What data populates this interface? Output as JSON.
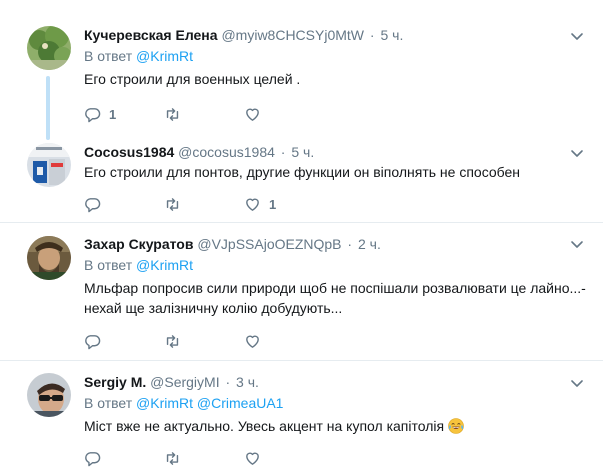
{
  "tweets": [
    {
      "name": "Кучеревская Елена",
      "handle": "@myiw8CHCSYj0MtW",
      "dot": "·",
      "time": "5 ч.",
      "reply_prefix": "В ответ",
      "reply_to": [
        "@KrimRt"
      ],
      "text": "Его строили для военных целей .",
      "replies": "1",
      "retweets": "",
      "likes": ""
    },
    {
      "name": "Cocosus1984",
      "handle": "@cocosus1984",
      "dot": "·",
      "time": "5 ч.",
      "text": "Его строили для понтов, другие функции он віполнять не способен",
      "replies": "",
      "retweets": "",
      "likes": "1"
    },
    {
      "name": "Захар Скуратов",
      "handle": "@VJpSSAjoOEZNQpB",
      "dot": "·",
      "time": "2 ч.",
      "reply_prefix": "В ответ",
      "reply_to": [
        "@KrimRt"
      ],
      "text_line1": "Мльфар попросив сили природи щоб не поспішали розвалювати це лайно...-",
      "text_line2": "нехай ще залізничну колію добудують...",
      "replies": "",
      "retweets": "",
      "likes": ""
    },
    {
      "name": "Sergiy M.",
      "handle": "@SergiyMI",
      "dot": "·",
      "time": "3 ч.",
      "reply_prefix": "В ответ",
      "reply_to": [
        "@KrimRt",
        "@CrimeaUA1"
      ],
      "text": "Міст вже не актуально. Увесь акцент на купол капітолія",
      "emoji": "face-with-tears-of-joy",
      "replies": "",
      "retweets": "",
      "likes": ""
    }
  ],
  "icons": {
    "reply": "reply-icon",
    "retweet": "retweet-icon",
    "like": "heart-icon",
    "caret": "chevron-down-icon"
  },
  "colors": {
    "link": "#1da1f2",
    "secondary": "#657786",
    "thread_line": "#bfe0f7",
    "divider": "#e6ecf0"
  }
}
